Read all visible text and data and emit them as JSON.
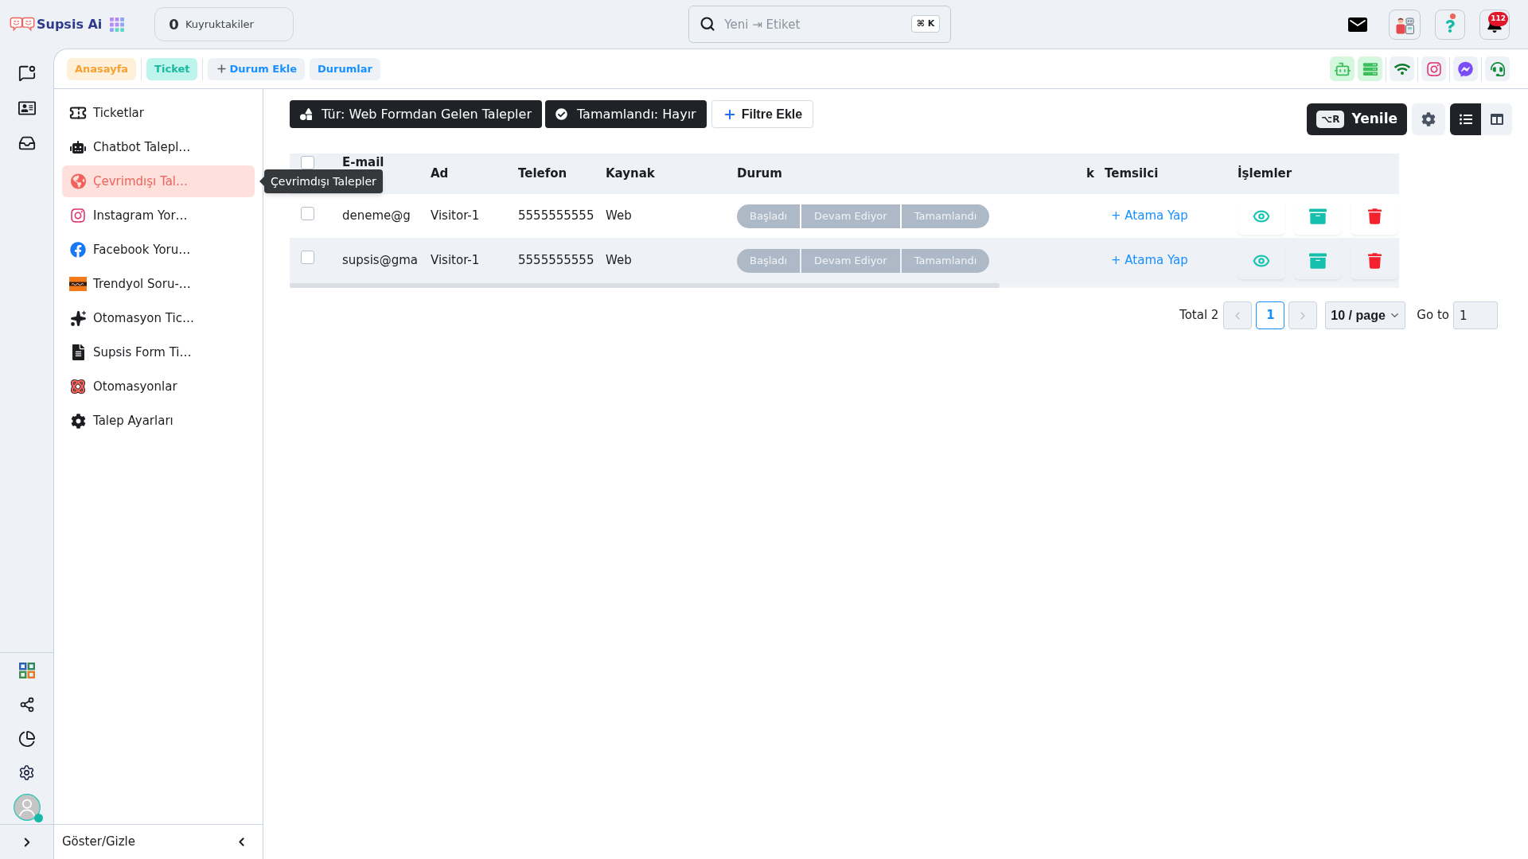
{
  "top_bar": {
    "brand": "Supsis Ai",
    "queue": {
      "count": "0",
      "label": "Kuyruktakiler"
    },
    "search": {
      "placeholder": "Yeni ⇥ Etiket",
      "shortcut": "⌘ K"
    },
    "notification_count": "112"
  },
  "tabs": [
    {
      "label": "Anasayfa",
      "kind": "home"
    },
    {
      "label": "Ticket",
      "kind": "current"
    },
    {
      "label": "Durum Ekle",
      "kind": "add"
    },
    {
      "label": "Durumlar",
      "kind": "link"
    }
  ],
  "channels": [
    {
      "kind": "bot",
      "active": true
    },
    {
      "kind": "list",
      "active": true
    },
    {
      "kind": "wifi",
      "active": false
    },
    {
      "kind": "instagram",
      "active": false
    },
    {
      "kind": "messenger",
      "active": false
    },
    {
      "kind": "headset",
      "active": false
    }
  ],
  "sidebar": {
    "items": [
      {
        "label": "Ticketlar",
        "kind": "ticket",
        "selected": false
      },
      {
        "label": "Chatbot Talepl…",
        "kind": "robot",
        "selected": false
      },
      {
        "label": "Çevrimdışı Tal…",
        "kind": "globe",
        "selected": true
      },
      {
        "label": "Instagram Yor…",
        "kind": "instagram",
        "selected": false
      },
      {
        "label": "Facebook Yoru…",
        "kind": "facebook",
        "selected": false
      },
      {
        "label": "Trendyol Soru-…",
        "kind": "tile",
        "selected": false
      },
      {
        "label": "Otomasyon Tic…",
        "kind": "sparkles",
        "selected": false
      },
      {
        "label": "Supsis Form Ti…",
        "kind": "document",
        "selected": false
      },
      {
        "label": "Otomasyonlar",
        "kind": "loops",
        "selected": false
      },
      {
        "label": "Talep Ayarları",
        "kind": "settings",
        "selected": false
      }
    ],
    "footer": "Göster/Gizle"
  },
  "tooltip": "Çevrimdışı Talepler",
  "filters": [
    {
      "label": "Tür: Web Formdan Gelen Talepler",
      "kind": "type"
    },
    {
      "label": "Tamamlandı: Hayır",
      "kind": "done"
    }
  ],
  "add_filter": "Filtre Ekle",
  "toolbar": {
    "refresh": {
      "label": "Yenile",
      "shortcut": "⌥R"
    },
    "views": [
      {
        "kind": "list",
        "selected": true
      },
      {
        "kind": "columns",
        "selected": false
      }
    ]
  },
  "table": {
    "header_checked": false,
    "columns": [
      "E-mail",
      "Ad",
      "Telefon",
      "Kaynak",
      "Durum",
      "k",
      "Temsilci",
      "İşlemler"
    ],
    "rows": [
      {
        "checked": false,
        "email": "deneme@g",
        "name": "Visitor-1",
        "phone": "5555555555",
        "source": "Web",
        "statuses": [
          {
            "label": "Başladı",
            "selected": false
          },
          {
            "label": "Devam Ediyor",
            "selected": false
          },
          {
            "label": "Tamamlandı",
            "selected": false
          }
        ],
        "assign": "+ Atama Yap"
      },
      {
        "checked": false,
        "email": "supsis@gma",
        "name": "Visitor-1",
        "phone": "5555555555",
        "source": "Web",
        "statuses": [
          {
            "label": "Başladı",
            "selected": false
          },
          {
            "label": "Devam Ediyor",
            "selected": false
          },
          {
            "label": "Tamamlandı",
            "selected": false
          }
        ],
        "assign": "+ Atama Yap"
      }
    ]
  },
  "pagination": {
    "total": "Total 2",
    "prev_disabled": true,
    "pages": [
      {
        "label": "1",
        "selected": true
      }
    ],
    "next_disabled": true,
    "page_size": "10 / page",
    "goto_label": "Go to",
    "goto_value": "1"
  }
}
